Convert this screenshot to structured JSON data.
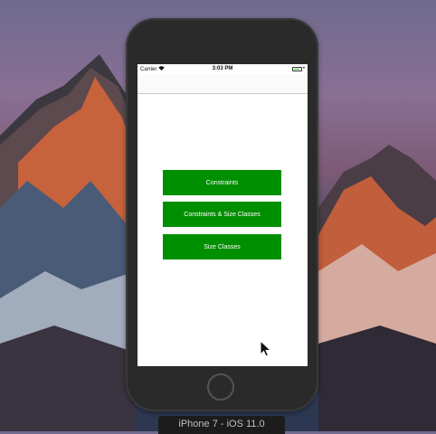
{
  "status_bar": {
    "carrier": "Carrier",
    "time": "3:03 PM",
    "battery_level": 0.8
  },
  "buttons": [
    {
      "label": "Constraints"
    },
    {
      "label": "Constraints & Size Classes"
    },
    {
      "label": "Size Classes"
    }
  ],
  "device_label": "iPhone 7 - iOS 11.0",
  "colors": {
    "button_bg": "#008f00",
    "button_text": "#ffffff",
    "screen_bg": "#ffffff",
    "device_frame": "#2a2a2a"
  },
  "icons": {
    "wifi": "wifi-icon",
    "battery": "battery-icon",
    "cursor": "pointer-cursor-icon"
  }
}
